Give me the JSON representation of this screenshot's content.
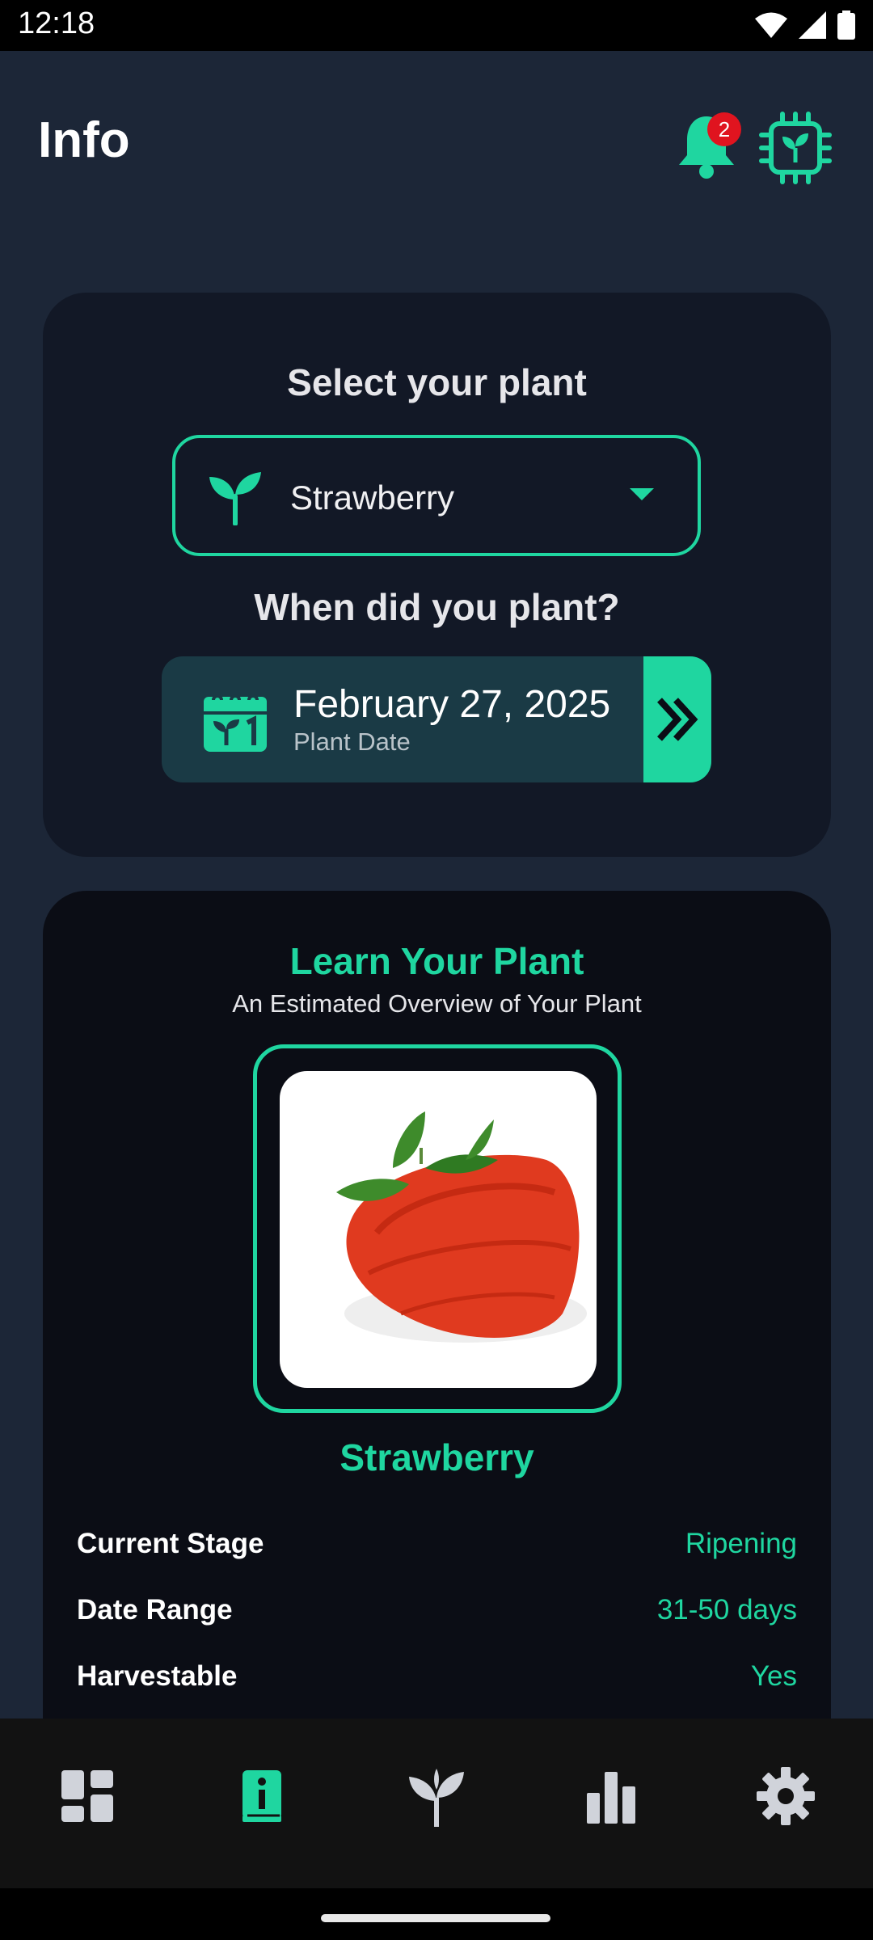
{
  "status": {
    "time": "12:18"
  },
  "header": {
    "title": "Info",
    "notification_count": "2"
  },
  "select_card": {
    "heading": "Select your plant",
    "selected_plant": "Strawberry",
    "date_heading": "When did you plant?",
    "date_value": "February 27, 2025",
    "date_caption": "Plant Date"
  },
  "learn_card": {
    "title": "Learn Your Plant",
    "subtitle": "An Estimated Overview of Your Plant",
    "plant_name": "Strawberry",
    "rows": [
      {
        "label": "Current Stage",
        "value": "Ripening"
      },
      {
        "label": "Date Range",
        "value": "31-50 days"
      },
      {
        "label": "Harvestable",
        "value": "Yes"
      }
    ]
  },
  "nav": {
    "items": [
      "dashboard-icon",
      "info-icon",
      "sprout-icon",
      "chart-icon",
      "settings-icon"
    ],
    "active": "info-icon"
  },
  "colors": {
    "background": "#1c2637",
    "accent": "#1fd6a0",
    "card": "#121826",
    "card_dark": "#0b0d15",
    "badge": "#e0141f"
  }
}
